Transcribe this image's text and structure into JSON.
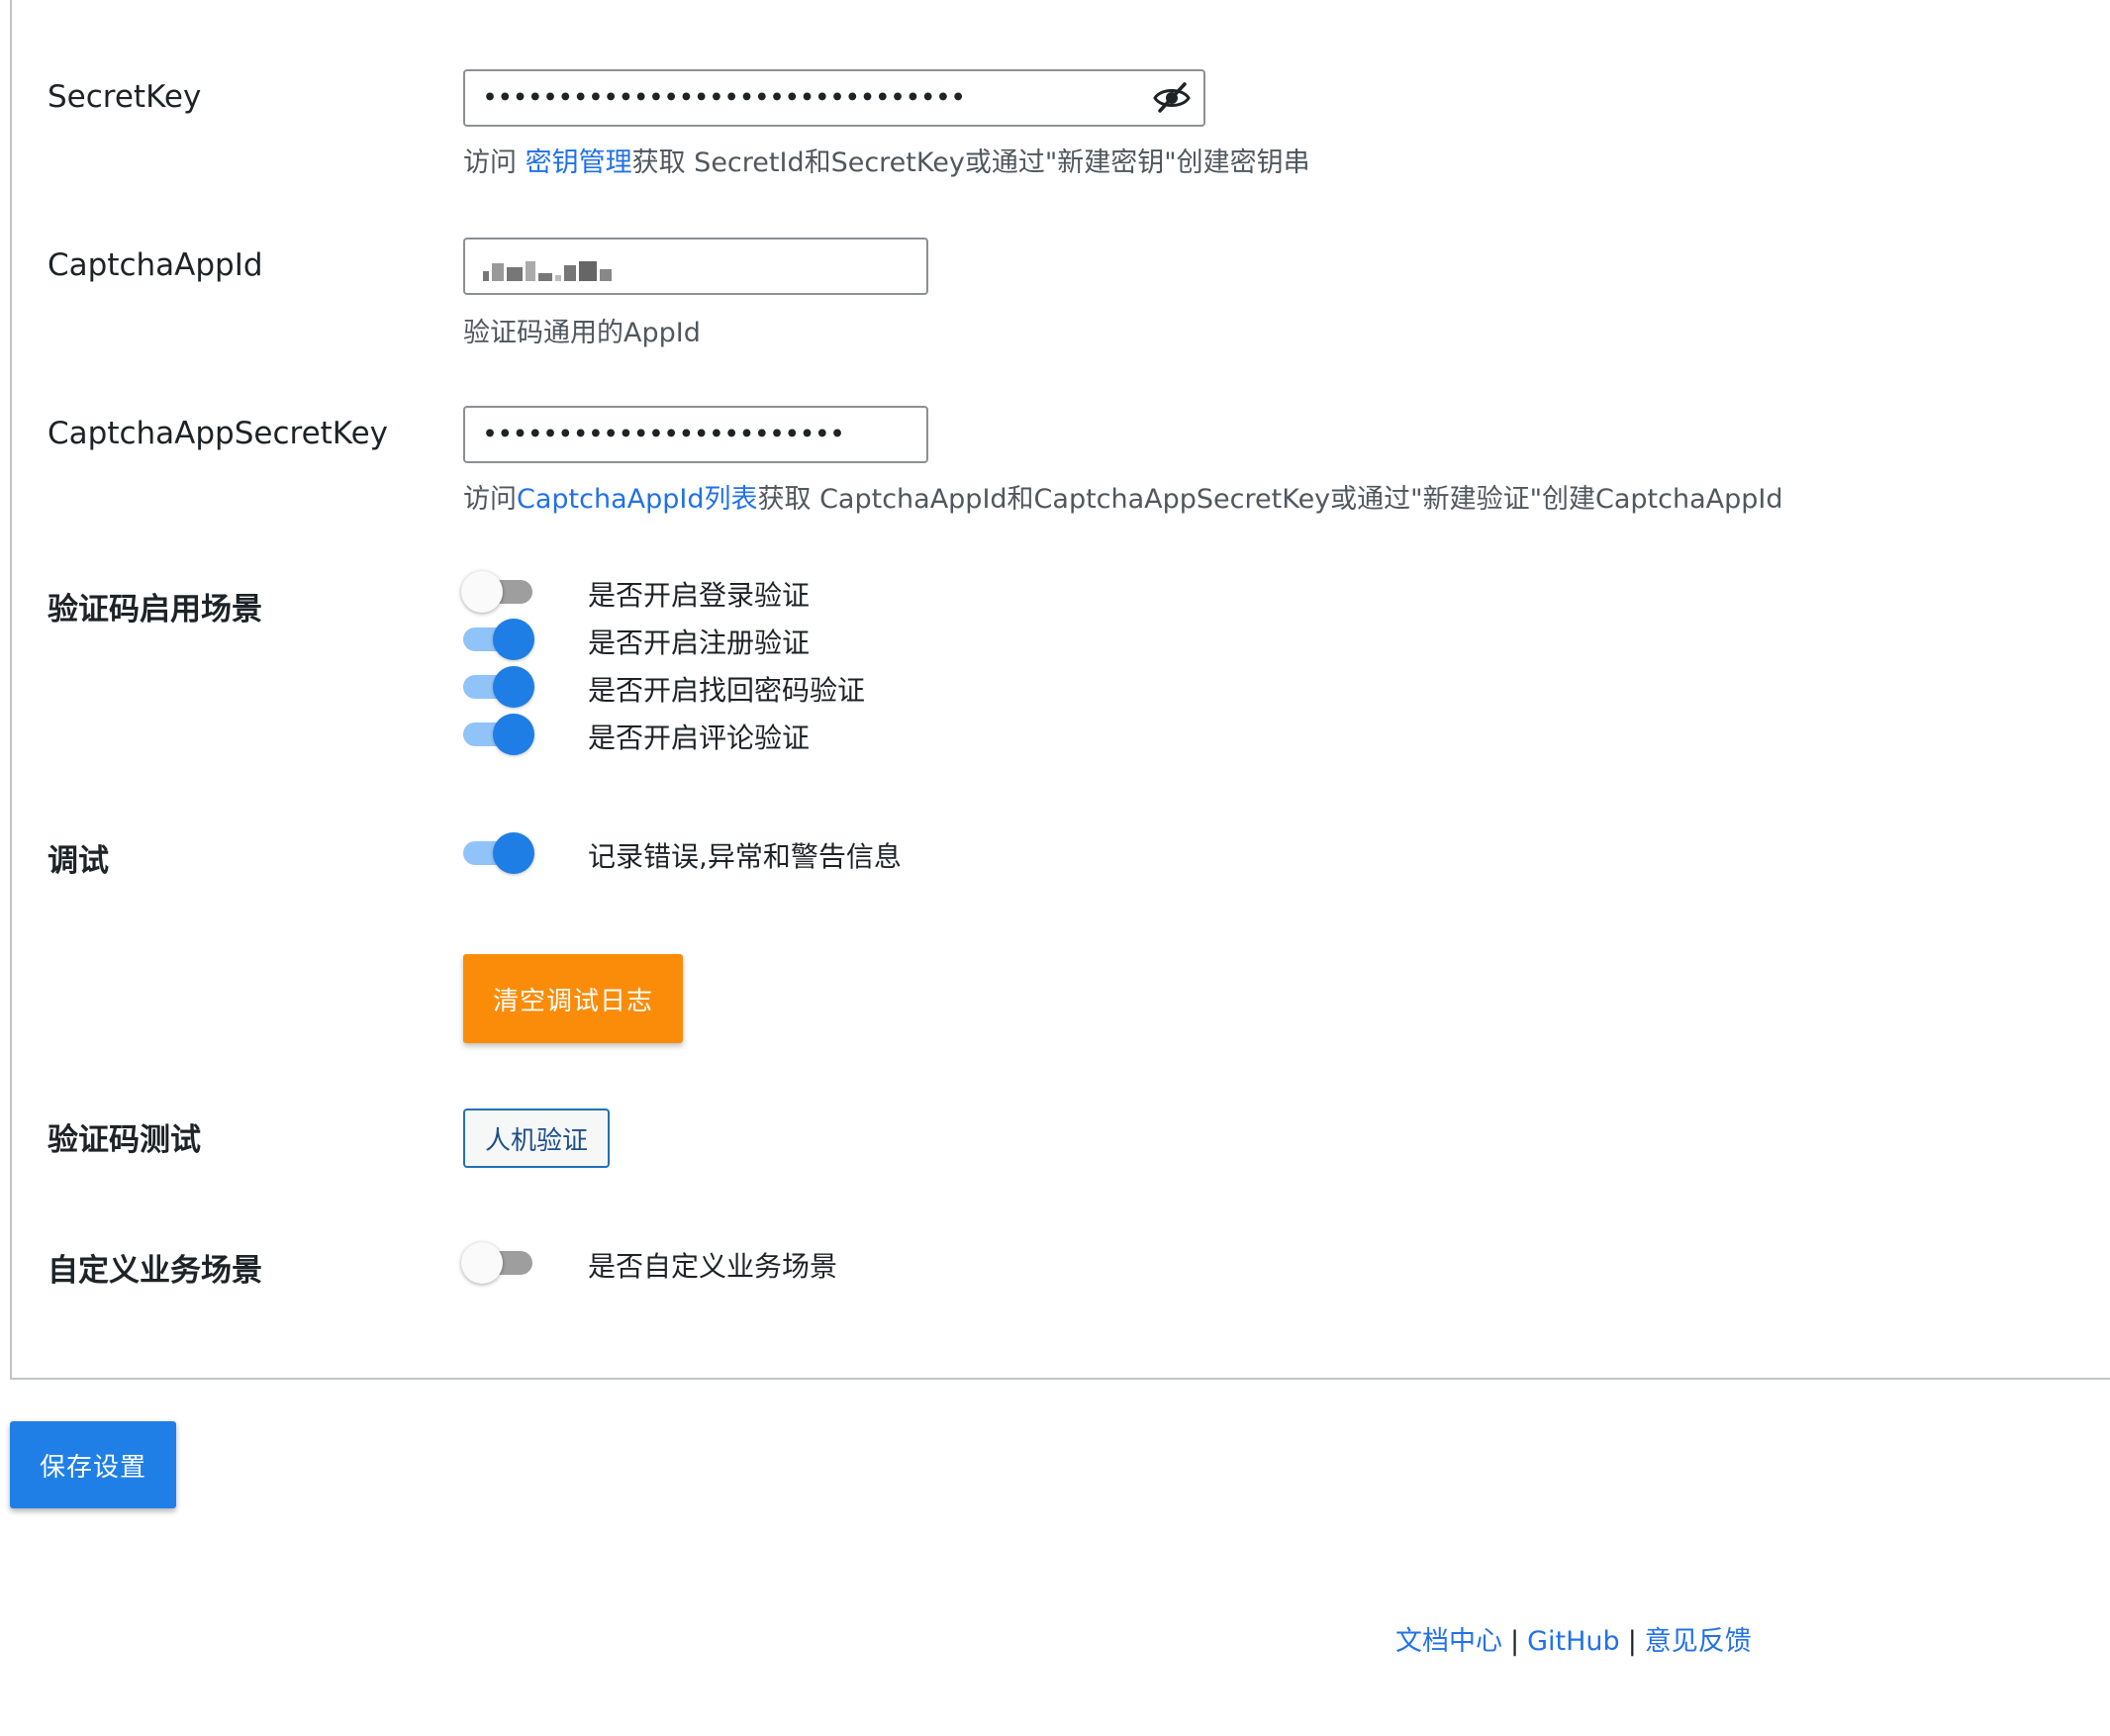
{
  "secretkey": {
    "label": "SecretKey",
    "value_masked": "••••••••••••••••••••••••••••••••",
    "help_prefix": "访问 ",
    "help_link": "密钥管理",
    "help_suffix": "获取 SecretId和SecretKey或通过\"新建密钥\"创建密钥串",
    "toggle_visibility_icon": "eye-slash-icon"
  },
  "captcha_appid": {
    "label": "CaptchaAppId",
    "help": "验证码通用的AppId"
  },
  "captcha_secret": {
    "label": "CaptchaAppSecretKey",
    "value_masked": "••••••••••••••••••••••••",
    "help_prefix": "访问",
    "help_link": "CaptchaAppId列表",
    "help_suffix": "获取 CaptchaAppId和CaptchaAppSecretKey或通过\"新建验证\"创建CaptchaAppId"
  },
  "scenes": {
    "label": "验证码启用场景",
    "items": [
      {
        "label": "是否开启登录验证",
        "on": false
      },
      {
        "label": "是否开启注册验证",
        "on": true
      },
      {
        "label": "是否开启找回密码验证",
        "on": true
      },
      {
        "label": "是否开启评论验证",
        "on": true
      }
    ]
  },
  "debug": {
    "label": "调试",
    "toggle_label": "记录错误,异常和警告信息",
    "on": true,
    "clear_button": "清空调试日志"
  },
  "captcha_test": {
    "label": "验证码测试",
    "button": "人机验证"
  },
  "custom_scene": {
    "label": "自定义业务场景",
    "toggle_label": "是否自定义业务场景",
    "on": false
  },
  "save_button": "保存设置",
  "footer": {
    "docs": "文档中心",
    "github": "GitHub",
    "feedback": "意见反馈",
    "separator": "|"
  },
  "colors": {
    "accent": "#1f7fe6",
    "orange": "#fb8c0a",
    "link": "#2271e8"
  }
}
